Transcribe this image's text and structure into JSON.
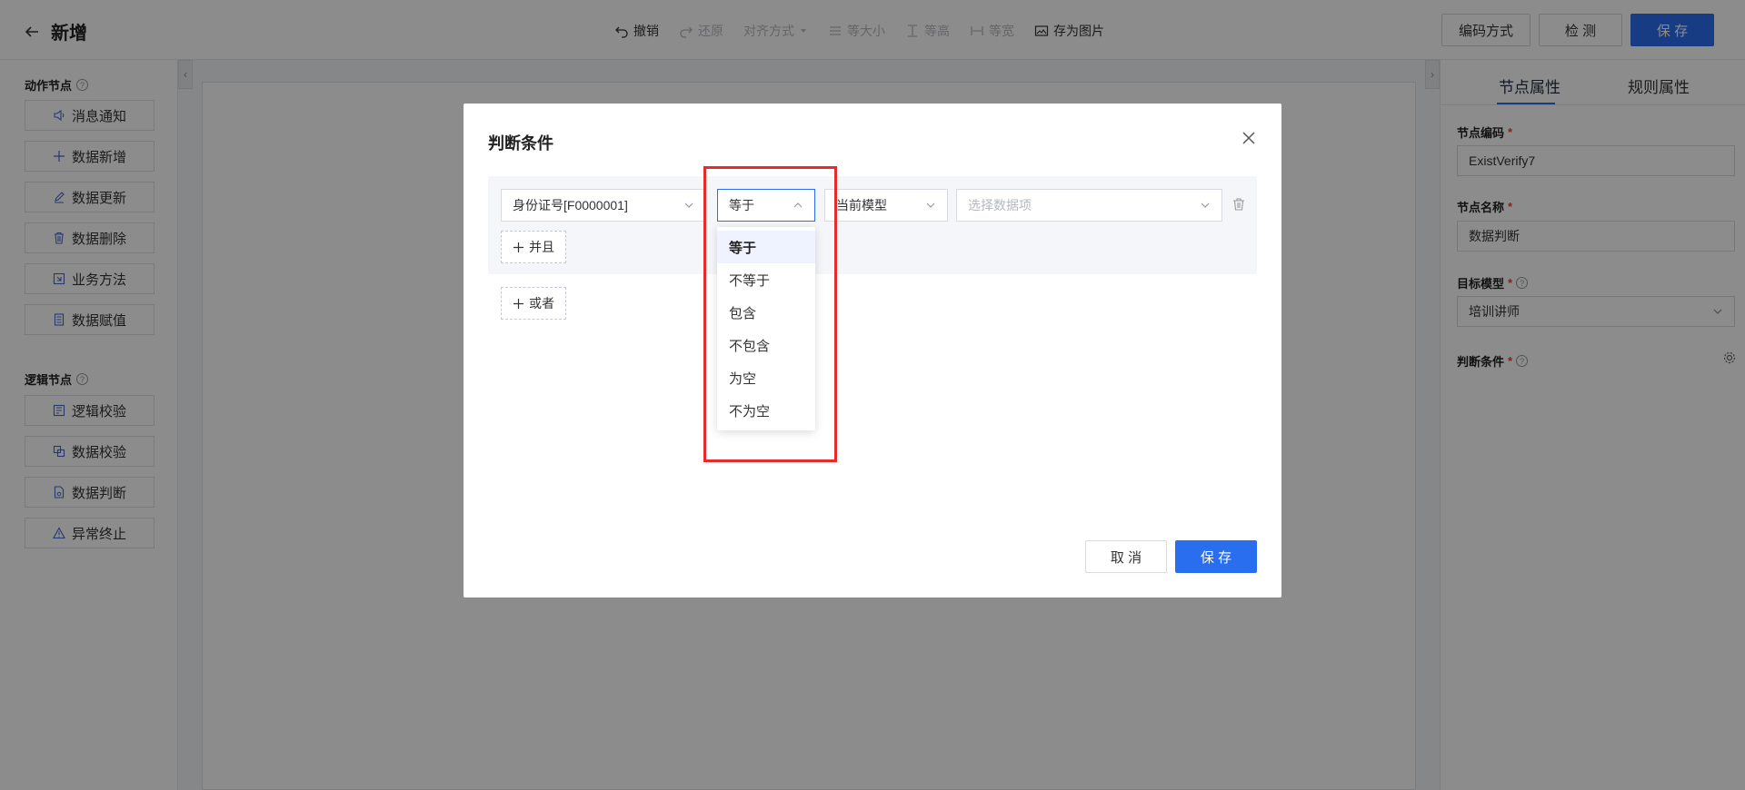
{
  "header": {
    "title": "新增",
    "tools": [
      {
        "label": "撤销",
        "icon": "undo-icon",
        "enabled": true
      },
      {
        "label": "还原",
        "icon": "redo-icon",
        "enabled": false
      },
      {
        "label": "对齐方式",
        "icon": "chevron-down-icon",
        "enabled": false
      },
      {
        "label": "等大小",
        "icon": "equal-size-icon",
        "enabled": false
      },
      {
        "label": "等高",
        "icon": "equal-height-icon",
        "enabled": false
      },
      {
        "label": "等宽",
        "icon": "equal-width-icon",
        "enabled": false
      },
      {
        "label": "存为图片",
        "icon": "image-icon",
        "enabled": true
      }
    ],
    "buttons": {
      "encode": "编码方式",
      "check": "检 测",
      "save": "保 存"
    }
  },
  "left_panel": {
    "action_title": "动作节点",
    "action_nodes": [
      {
        "label": "消息通知",
        "icon": "speaker-icon"
      },
      {
        "label": "数据新增",
        "icon": "plus-icon"
      },
      {
        "label": "数据更新",
        "icon": "pen-icon"
      },
      {
        "label": "数据删除",
        "icon": "trash-icon"
      },
      {
        "label": "业务方法",
        "icon": "method-icon"
      },
      {
        "label": "数据赋值",
        "icon": "document-icon"
      }
    ],
    "logic_title": "逻辑节点",
    "logic_nodes": [
      {
        "label": "逻辑校验",
        "icon": "checklist-icon"
      },
      {
        "label": "数据校验",
        "icon": "copy-icon"
      },
      {
        "label": "数据判断",
        "icon": "file-judge-icon"
      },
      {
        "label": "异常终止",
        "icon": "warning-icon"
      }
    ]
  },
  "right_panel": {
    "tabs": [
      "节点属性",
      "规则属性"
    ],
    "active_tab": "节点属性",
    "fields": {
      "code_label": "节点编码",
      "code_value": "ExistVerify7",
      "name_label": "节点名称",
      "name_value": "数据判断",
      "model_label": "目标模型",
      "model_value": "培训讲师",
      "condition_label": "判断条件"
    }
  },
  "modal": {
    "title": "判断条件",
    "field_select": "身份证号[F0000001]",
    "operator_select": "等于",
    "source_select": "当前模型",
    "value_placeholder": "选择数据项",
    "and_label": "并且",
    "or_label": "或者",
    "cancel_label": "取 消",
    "save_label": "保 存",
    "operator_options": [
      "等于",
      "不等于",
      "包含",
      "不包含",
      "为空",
      "不为空"
    ],
    "selected_option": "等于"
  },
  "colors": {
    "primary": "#2a6ef0",
    "highlight": "#e52b2b"
  }
}
